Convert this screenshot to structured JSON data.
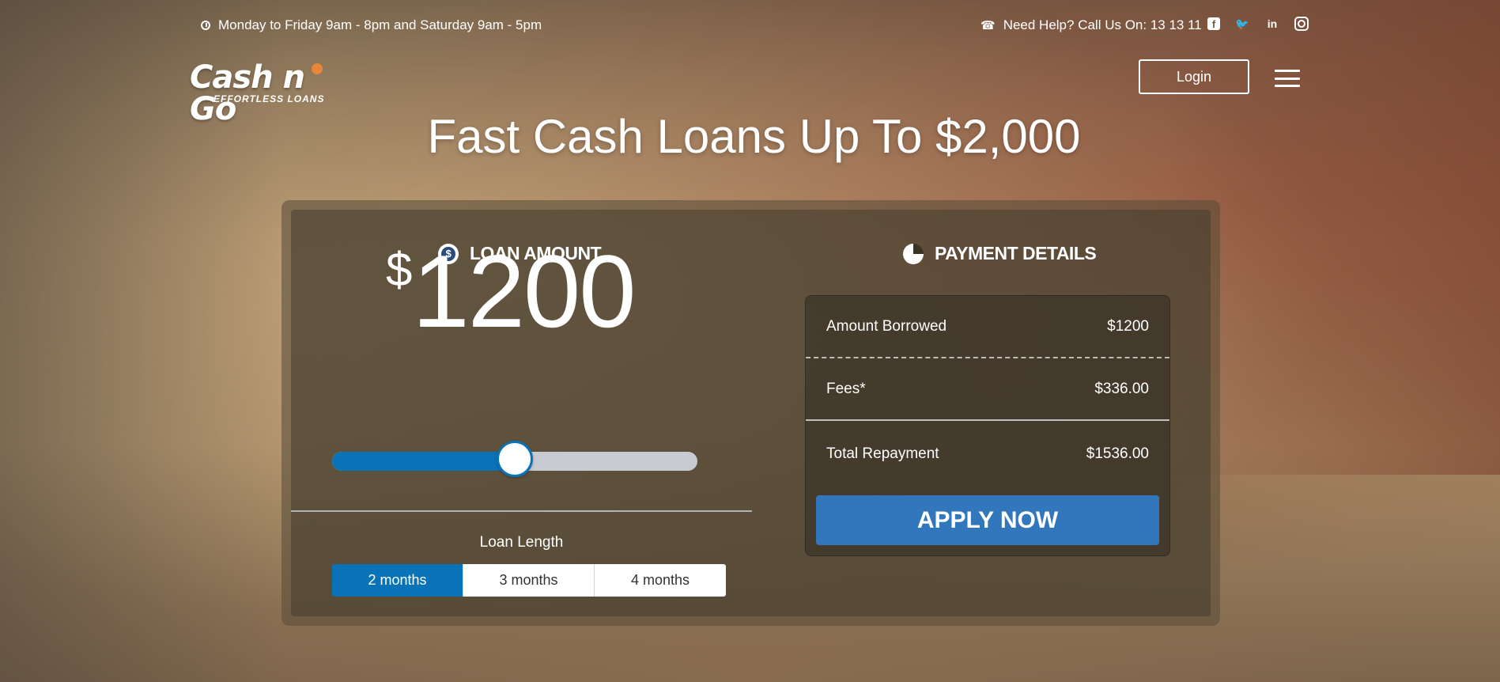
{
  "topbar": {
    "hours": "Monday to Friday 9am - 8pm and Saturday 9am - 5pm",
    "help": "Need Help? Call Us On: 13 13 11",
    "socials": [
      "facebook-icon",
      "twitter-icon",
      "linkedin-icon",
      "instagram-icon"
    ]
  },
  "logo": {
    "main": "Cash n Go",
    "tagline": "EFFORTLESS LOANS"
  },
  "header": {
    "login_label": "Login"
  },
  "hero": {
    "title": "Fast Cash Loans Up To $2,000"
  },
  "loan": {
    "section_title": "LOAN AMOUNT",
    "currency_symbol": "$",
    "amount": "1200",
    "slider_fraction": 0.5,
    "length_label": "Loan Length",
    "length_options": [
      "2 months",
      "3 months",
      "4 months"
    ],
    "selected_length": "2 months"
  },
  "payment": {
    "section_title": "PAYMENT DETAILS",
    "rows": [
      {
        "label": "Amount Borrowed",
        "value": "$1200"
      },
      {
        "label": "Fees*",
        "value": "$336.00"
      },
      {
        "label": "Total Repayment",
        "value": "$1536.00"
      }
    ],
    "apply_label": "APPLY NOW"
  },
  "colors": {
    "primary_blue": "#0a73b8",
    "apply_blue": "#3277bb",
    "accent_orange": "#e8863a"
  }
}
